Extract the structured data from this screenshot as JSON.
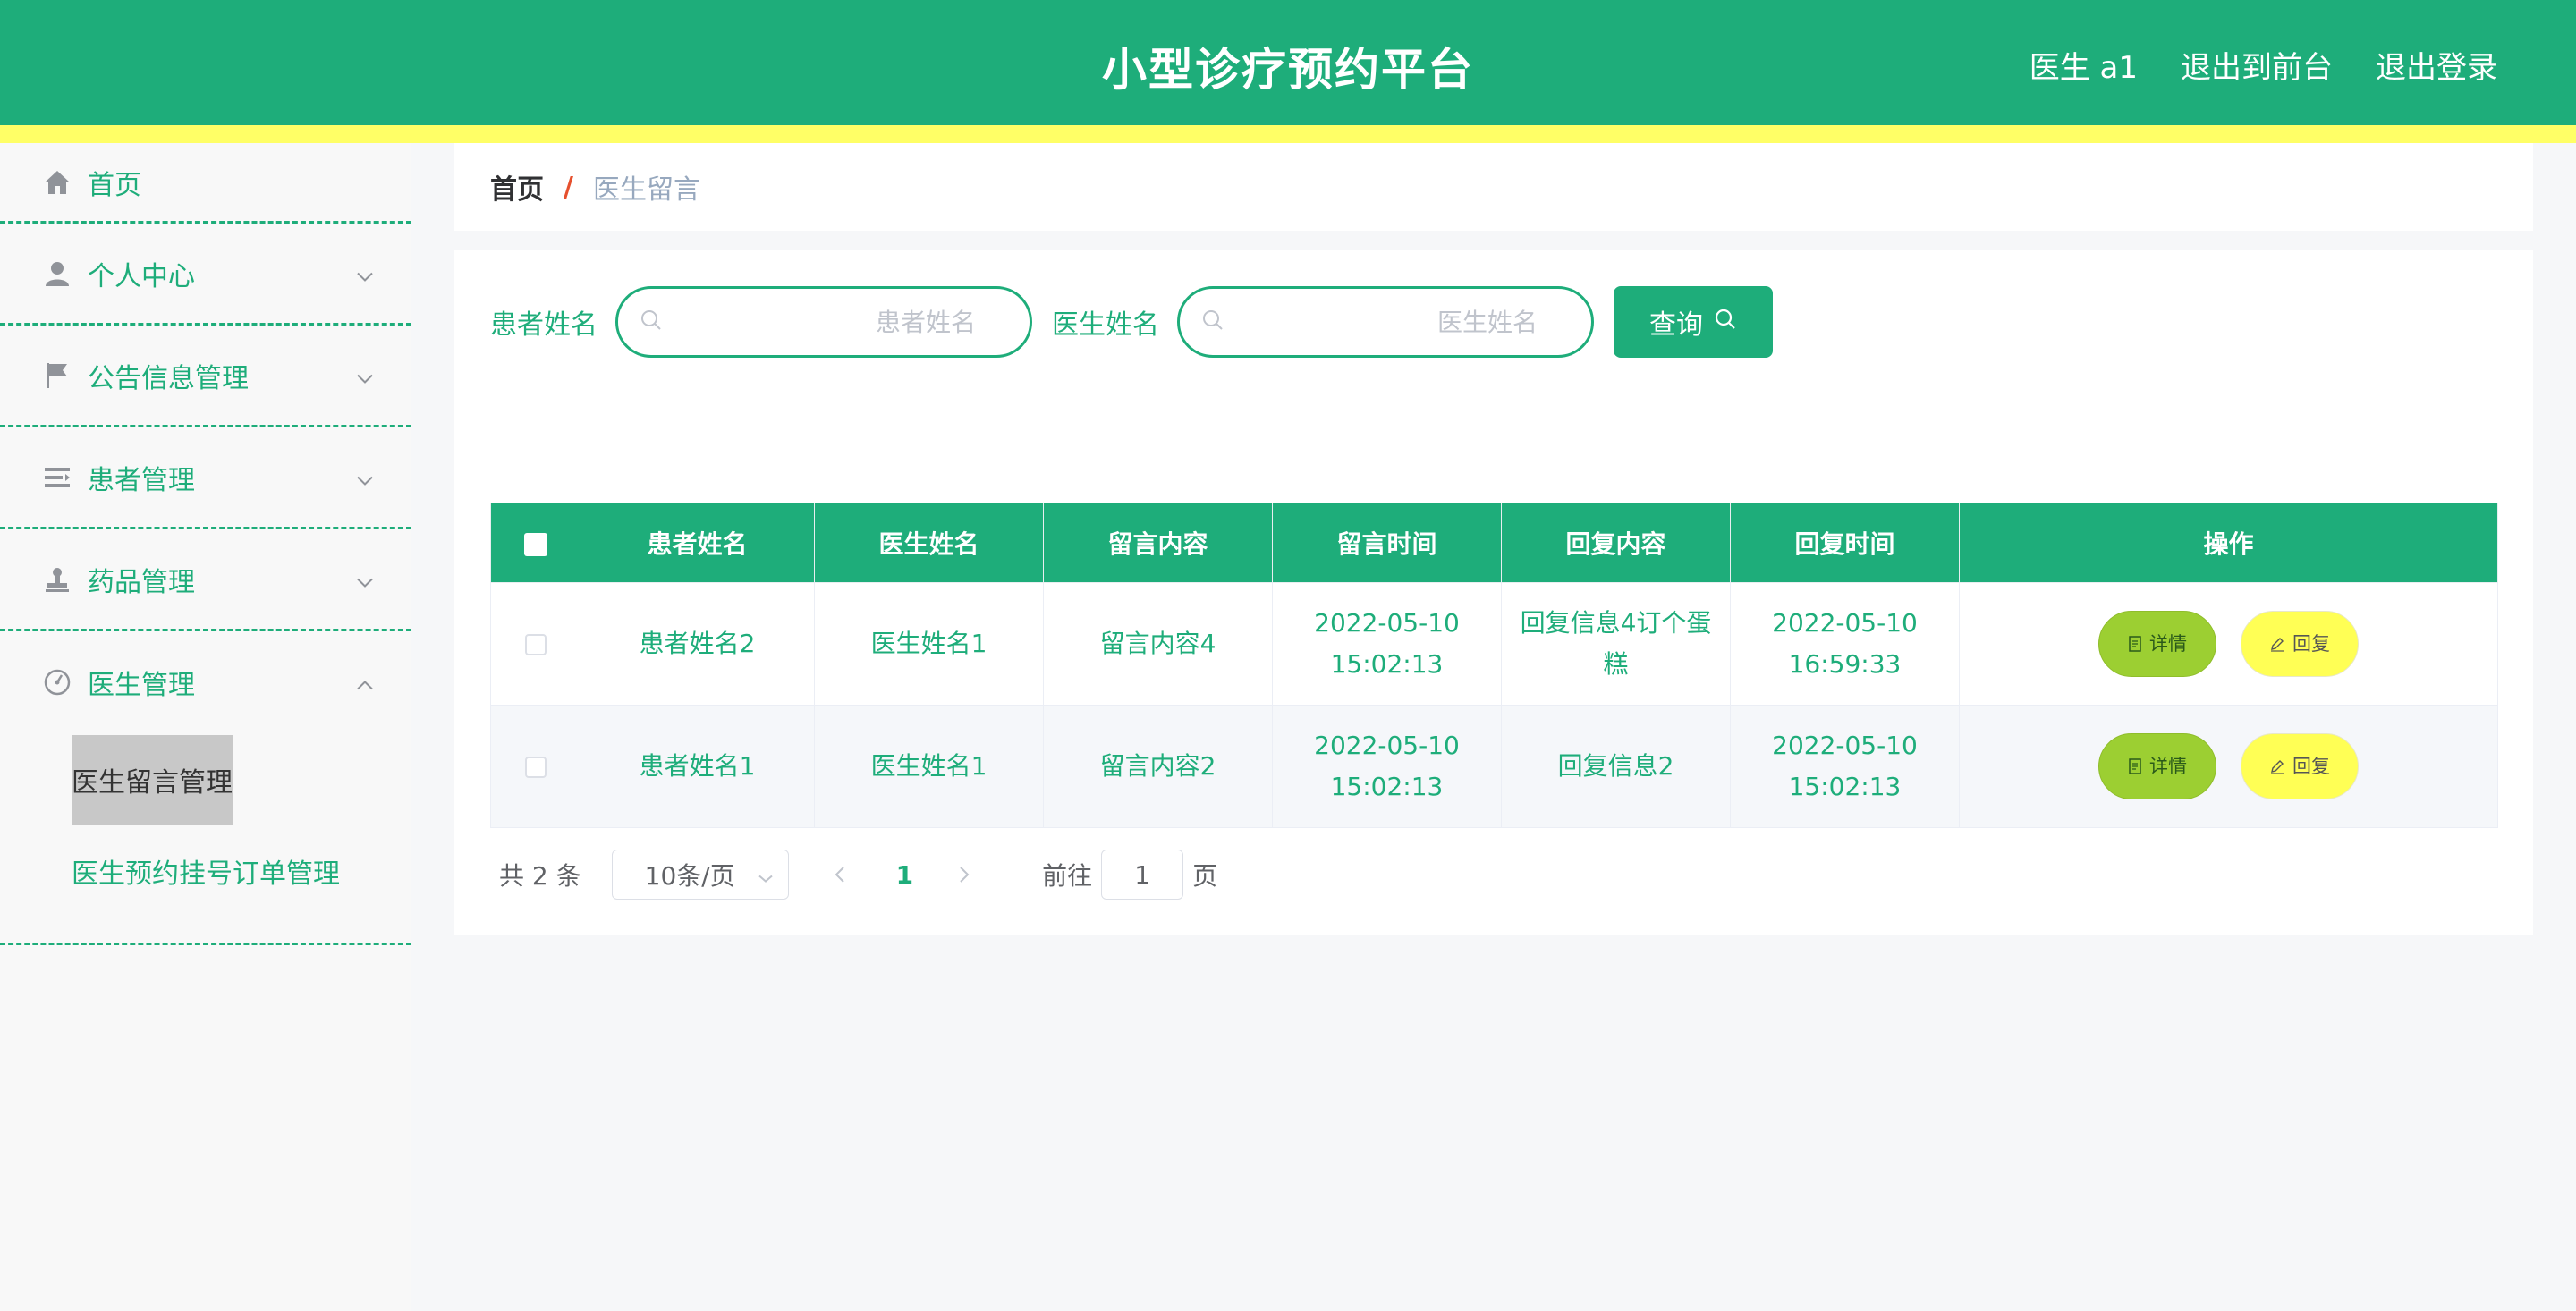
{
  "header": {
    "title": "小型诊疗预约平台",
    "links": [
      "医生 a1",
      "退出到前台",
      "退出登录"
    ]
  },
  "sidebar": {
    "items": [
      {
        "label": "首页",
        "icon": "home-icon"
      },
      {
        "label": "个人中心",
        "icon": "user-icon"
      },
      {
        "label": "公告信息管理",
        "icon": "flag-icon"
      },
      {
        "label": "患者管理",
        "icon": "list-icon"
      },
      {
        "label": "药品管理",
        "icon": "stamp-icon"
      },
      {
        "label": "医生管理",
        "icon": "gauge-icon"
      }
    ],
    "submenu": [
      "医生留言管理",
      "医生预约挂号订单管理"
    ]
  },
  "breadcrumb": {
    "home": "首页",
    "separator": "/",
    "current": "医生留言"
  },
  "search": {
    "patient_label": "患者姓名",
    "patient_placeholder": "患者姓名",
    "doctor_label": "医生姓名",
    "doctor_placeholder": "医生姓名",
    "query_button": "查询"
  },
  "table": {
    "columns": [
      "患者姓名",
      "医生姓名",
      "留言内容",
      "留言时间",
      "回复内容",
      "回复时间",
      "操作"
    ],
    "rows": [
      {
        "patient": "患者姓名2",
        "doctor": "医生姓名1",
        "content": "留言内容4",
        "time": "2022-05-10 15:02:13",
        "reply": "回复信息4订个蛋糕",
        "reply_time": "2022-05-10 16:59:33"
      },
      {
        "patient": "患者姓名1",
        "doctor": "医生姓名1",
        "content": "留言内容2",
        "time": "2022-05-10 15:02:13",
        "reply": "回复信息2",
        "reply_time": "2022-05-10 15:02:13"
      }
    ],
    "detail_button": "详情",
    "reply_button": "回复"
  },
  "pagination": {
    "total": "共 2 条",
    "page_size": "10条/页",
    "current_page": "1",
    "goto_label": "前往",
    "goto_value": "1",
    "page_suffix": "页"
  },
  "colors": {
    "primary": "#1ead7a",
    "stripe": "#ffff66",
    "detail": "#9ccf32",
    "reply": "#ffff55"
  }
}
